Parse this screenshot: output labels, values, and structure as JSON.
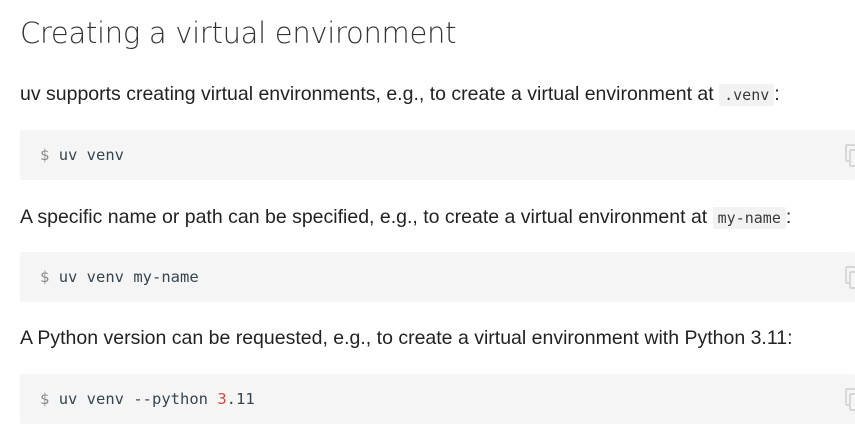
{
  "section": {
    "heading": "Creating a virtual environment"
  },
  "paragraphs": [
    {
      "before": "uv supports creating virtual environments, e.g., to create a virtual environment at ",
      "code": ".venv",
      "after": ":"
    },
    {
      "before": "A specific name or path can be specified, e.g., to create a virtual environment at ",
      "code": "my-name",
      "after": ":"
    },
    {
      "text": "A Python version can be requested, e.g., to create a virtual environment with Python 3.11:"
    }
  ],
  "code_blocks": [
    {
      "prompt": "$",
      "command": "uv venv"
    },
    {
      "prompt": "$",
      "command": "uv venv my-name"
    },
    {
      "prompt": "$",
      "command_prefix": "uv venv --python ",
      "number": "3",
      "command_suffix": ".11"
    }
  ],
  "icons": {
    "copy": "copy-icon"
  },
  "colors": {
    "code_background": "#f5f5f5",
    "number_literal": "#d14a3b",
    "prompt": "#8a8a8a"
  }
}
